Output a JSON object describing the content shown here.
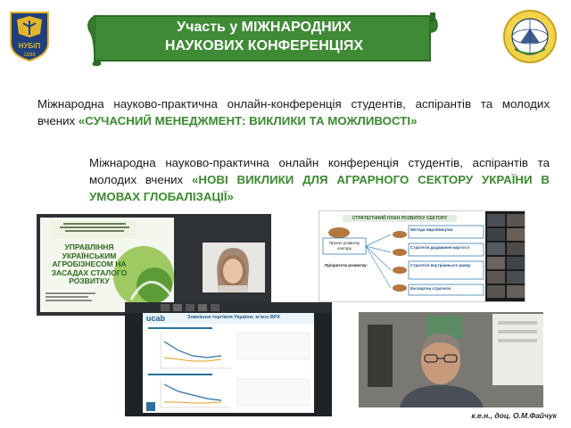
{
  "logo_left": {
    "text": "НУБіП",
    "year": "1898"
  },
  "banner": {
    "line1": "Участь у МІЖНАРОДНИХ",
    "line2": "НАУКОВИХ КОНФЕРЕНЦІЯХ"
  },
  "paragraph1": {
    "text": "Міжнародна науково-практична онлайн-конференція студентів, аспірантів та молодих вчених ",
    "highlight": "«СУЧАСНИЙ МЕНЕДЖМЕНТ: ВИКЛИКИ ТА МОЖЛИВОСТІ»"
  },
  "paragraph2": {
    "text": "Міжнародна науково-практична онлайн конференція студентів, аспірантів та молодих вчених ",
    "highlight": "«НОВІ ВИКЛИКИ ДЛЯ АГРАРНОГО СЕКТОРУ УКРАЇНИ В УМОВАХ ГЛОБАЛІЗАЦІЇ»"
  },
  "screenshot1": {
    "slide_title": "УПРАВЛІННЯ УКРАЇНСЬКИМ АГРОБІЗНЕСОМ НА ЗАСАДАХ СТАЛОГО РОЗВИТКУ"
  },
  "screenshot2": {
    "slide_title": "СТРАТЕГІЧНИЙ ПЛАН РОЗВИТКУ СЕКТОРУ",
    "box_left": "Проект розвитку сектору",
    "boxes": [
      "Методи виробництва",
      "Стратегія додавання вартості",
      "Стратегія внутрішнього ринку",
      "Експортна стратегія"
    ],
    "priorities_title": "Пріоритети розвитку:"
  },
  "screenshot3": {
    "brand": "ucab",
    "slide_title": "Зовнішня торгівля України: м'ясо ВРХ"
  },
  "footer": "к.е.н., доц. О.М.Файчук",
  "colors": {
    "banner_green": "#3f8a35",
    "highlight_green": "#3a8a2e",
    "dark_blue": "#1f3f7a",
    "gold": "#e2b42b"
  }
}
